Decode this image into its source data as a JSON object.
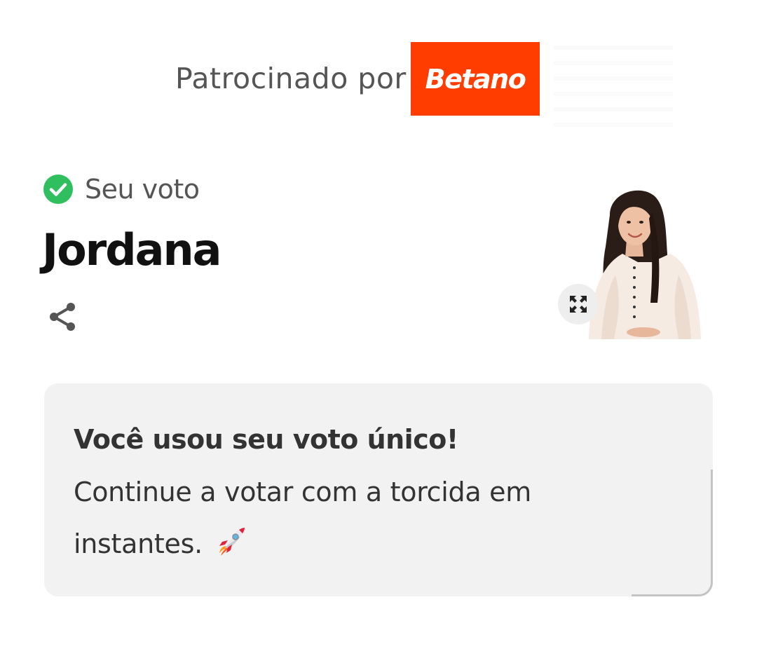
{
  "sponsor": {
    "label": "Patrocinado por",
    "logo_text": "Betano",
    "logo_color": "#ff3d00"
  },
  "vote": {
    "status_label": "Seu voto",
    "status_icon": "check-circle-icon",
    "status_color": "#2fbf5f",
    "candidate_name": "Jordana",
    "share_icon": "share-icon",
    "expand_icon": "expand-icon"
  },
  "message": {
    "title": "Você usou seu voto único!",
    "body": "Continue a votar com a torcida em instantes.",
    "icon": "rocket-icon"
  }
}
